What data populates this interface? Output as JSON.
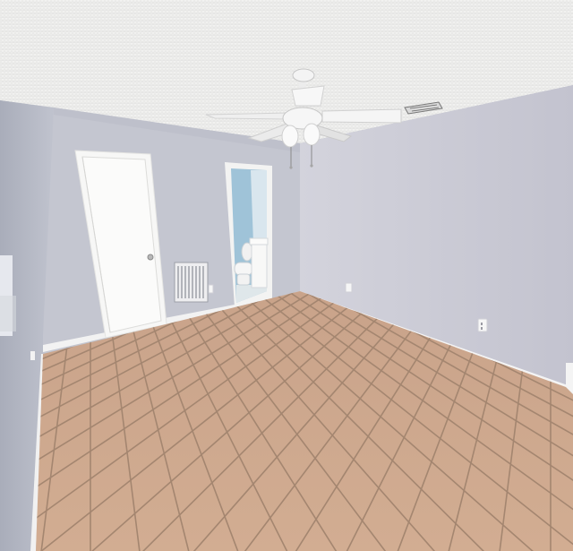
{
  "scene": {
    "kind": "photo",
    "description_free": true,
    "colors": {
      "ceiling": "#eeeeec",
      "wall_left": "#bcbfcb",
      "wall_back": "#c4c6d0",
      "wall_right": "#c9c9d4",
      "floor": "#c9a58a",
      "grout": "#a88a72",
      "baseboard": "#f3f3f3",
      "door": "#f7f7f5",
      "bathroom_wall": "#9fc3d8"
    },
    "objects": [
      "ceiling-fan-icon",
      "closet-door",
      "bathroom-doorway",
      "toilet-icon",
      "air-vent-icon",
      "tile-floor",
      "window-edge"
    ]
  }
}
